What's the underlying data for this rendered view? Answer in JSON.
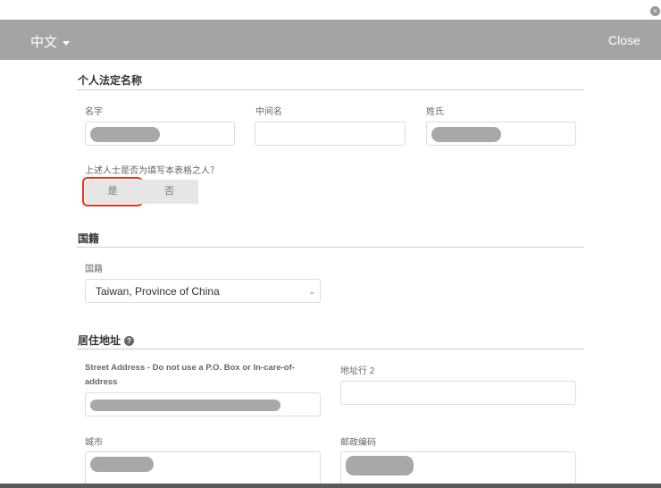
{
  "header": {
    "language": "中文",
    "close_label": "Close",
    "top_close": "×"
  },
  "legal_name": {
    "title": "个人法定名称",
    "first_name_label": "名字",
    "middle_name_label": "中间名",
    "last_name_label": "姓氏",
    "middle_name_value": ""
  },
  "filler_question": {
    "label": "上述人士是否为填写本表格之人？",
    "yes": "是",
    "no": "否"
  },
  "nationality": {
    "title": "国籍",
    "label": "国籍",
    "selected": "Taiwan, Province of China",
    "chevron": "⌄"
  },
  "address": {
    "title": "居住地址",
    "help": "?",
    "street_label": "Street Address - Do not use a P.O. Box or In-care-of-address",
    "line2_label": "地址行 2",
    "city_label": "城市",
    "postal_label": "邮政编码",
    "line2_value": ""
  },
  "colors": {
    "header": "#a4a4a4",
    "highlight": "#e8321e"
  }
}
